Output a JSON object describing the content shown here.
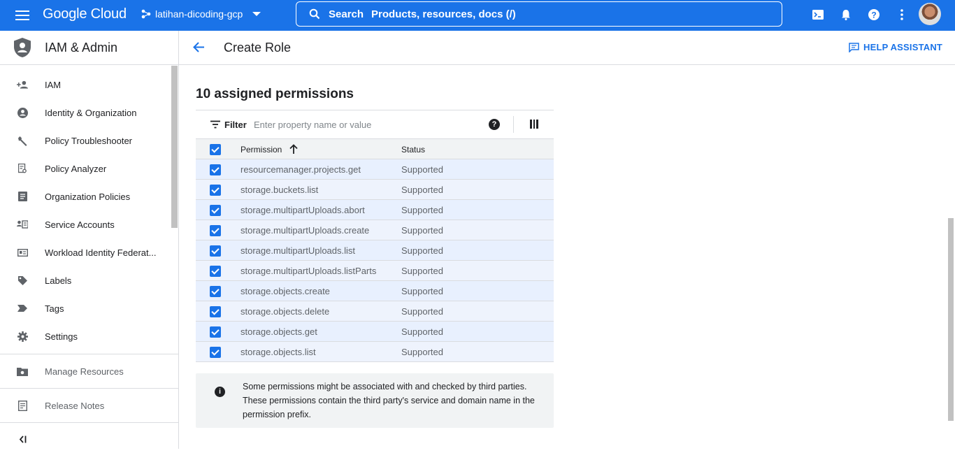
{
  "topbar": {
    "logo": "Google Cloud",
    "project": "latihan-dicoding-gcp",
    "search_label": "Search",
    "search_placeholder": "Products, resources, docs (/)"
  },
  "sidebar": {
    "title": "IAM & Admin",
    "items": [
      {
        "label": "IAM",
        "icon": "person-add-icon"
      },
      {
        "label": "Identity & Organization",
        "icon": "account-circle-icon"
      },
      {
        "label": "Policy Troubleshooter",
        "icon": "wrench-icon"
      },
      {
        "label": "Policy Analyzer",
        "icon": "document-search-icon"
      },
      {
        "label": "Organization Policies",
        "icon": "document-list-icon"
      },
      {
        "label": "Service Accounts",
        "icon": "service-account-icon"
      },
      {
        "label": "Workload Identity Federat...",
        "icon": "id-card-icon"
      },
      {
        "label": "Labels",
        "icon": "tag-icon"
      },
      {
        "label": "Tags",
        "icon": "chevron-tag-icon"
      },
      {
        "label": "Settings",
        "icon": "gear-icon"
      }
    ],
    "manage_resources": "Manage Resources",
    "release_notes": "Release Notes",
    "collapse": "<|"
  },
  "header": {
    "title": "Create Role",
    "help": "HELP ASSISTANT"
  },
  "permissions": {
    "title": "10 assigned permissions",
    "filter_label": "Filter",
    "filter_placeholder": "Enter property name or value",
    "col_permission": "Permission",
    "col_status": "Status",
    "rows": [
      {
        "name": "resourcemanager.projects.get",
        "status": "Supported"
      },
      {
        "name": "storage.buckets.list",
        "status": "Supported"
      },
      {
        "name": "storage.multipartUploads.abort",
        "status": "Supported"
      },
      {
        "name": "storage.multipartUploads.create",
        "status": "Supported"
      },
      {
        "name": "storage.multipartUploads.list",
        "status": "Supported"
      },
      {
        "name": "storage.multipartUploads.listParts",
        "status": "Supported"
      },
      {
        "name": "storage.objects.create",
        "status": "Supported"
      },
      {
        "name": "storage.objects.delete",
        "status": "Supported"
      },
      {
        "name": "storage.objects.get",
        "status": "Supported"
      },
      {
        "name": "storage.objects.list",
        "status": "Supported"
      }
    ]
  },
  "info": {
    "text": "Some permissions might be associated with and checked by third parties. These permissions contain the third party's service and domain name in the permission prefix."
  },
  "colors": {
    "brand_blue": "#1a73e8",
    "row_bg": "#e8f0fe"
  }
}
